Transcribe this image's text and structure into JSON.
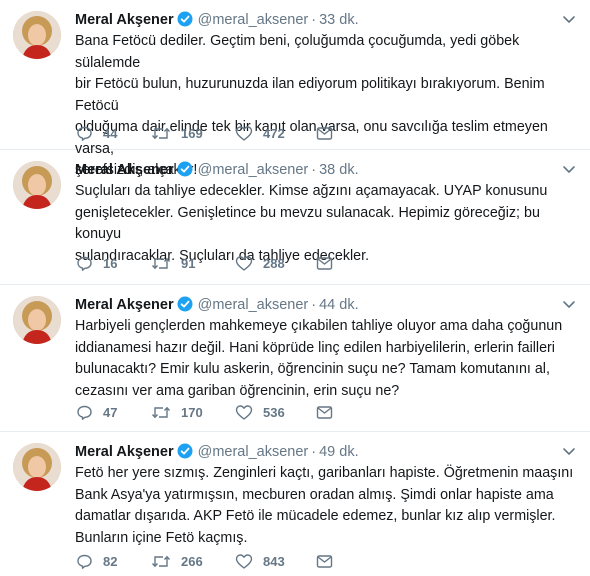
{
  "tweets": [
    {
      "author": "Meral Akşener",
      "handle": "@meral_aksener",
      "separator": "·",
      "time": "33 dk.",
      "text": "Bana Fetöcü dediler. Geçtim beni, çoluğumda çocuğumda, yedi göbek sülalemde\nbir Fetöcü bulun, huzurunuzda ilan ediyorum politikayı bırakıyorum. Benim Fetöcü\nolduğuma dair elinde tek bir kanıt olan varsa, onu savcılığa teslim etmeyen varsa,\nşerefsizdir, alçaktır!",
      "replies": "44",
      "retweets": "169",
      "likes": "472"
    },
    {
      "author": "Meral Akşener",
      "handle": "@meral_aksener",
      "separator": "·",
      "time": "38 dk.",
      "text": "Suçluları da tahliye edecekler. Kimse ağzını açamayacak. UYAP konusunu\ngenişletecekler. Genişletince bu mevzu sulanacak. Hepimiz göreceğiz; bu konuyu\nsulandıracaklar. Suçluları da tahliye edecekler.",
      "replies": "16",
      "retweets": "91",
      "likes": "288"
    },
    {
      "author": "Meral Akşener",
      "handle": "@meral_aksener",
      "separator": "·",
      "time": "44 dk.",
      "text": "Harbiyeli gençlerden mahkemeye çıkabilen tahliye oluyor ama daha çoğunun\niddianamesi hazır değil. Hani köprüde linç edilen harbiyelilerin, erlerin failleri\nbulunacaktı? Emir kulu askerin, öğrencinin suçu ne? Tamam komutanını al,\ncezasını ver ama gariban öğrencinin, erin suçu ne?",
      "replies": "47",
      "retweets": "170",
      "likes": "536"
    },
    {
      "author": "Meral Akşener",
      "handle": "@meral_aksener",
      "separator": "·",
      "time": "49 dk.",
      "text": "Fetö her yere sızmış. Zenginleri kaçtı, garibanları hapiste. Öğretmenin maaşını\nBank Asya'ya yatırmışsın, mecburen oradan almış. Şimdi onlar hapiste ama\ndamatlar dışarıda. AKP Fetö ile mücadele edemez, bunlar kız alıp vermişler.\nBunların içine Fetö kaçmış.",
      "replies": "82",
      "retweets": "266",
      "likes": "843"
    }
  ],
  "icons": {
    "verified": "verified-badge-icon",
    "caret": "chevron-down-icon",
    "reply": "reply-icon",
    "retweet": "retweet-icon",
    "like": "heart-icon",
    "dm": "envelope-icon"
  },
  "colors": {
    "verified_blue": "#1da1f2",
    "meta_gray": "#657786",
    "text": "#14171a",
    "divider": "#e6ecf0"
  }
}
